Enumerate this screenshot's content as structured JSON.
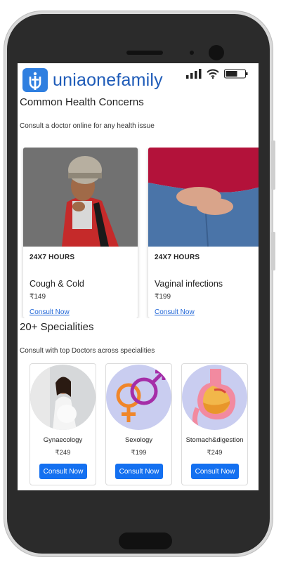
{
  "app": {
    "title": "uniaonefamily"
  },
  "status_icons": [
    "signal-icon",
    "wifi-icon",
    "battery-icon"
  ],
  "health_concerns": {
    "title": "Common Health Concerns",
    "subtitle": "Consult a doctor online for any health issue",
    "cards": [
      {
        "hours": "24X7 HOURS",
        "name": "Cough & Cold",
        "price": "₹149",
        "link": "Consult Now"
      },
      {
        "hours": "24X7 HOURS",
        "name": "Vaginal infections",
        "price": "₹199",
        "link": "Consult Now"
      }
    ]
  },
  "specialities": {
    "title": "20+ Specialities",
    "subtitle": "Consult with top Doctors across specialities",
    "items": [
      {
        "name": "Gynaecology",
        "price": "₹249",
        "button": "Consult Now"
      },
      {
        "name": "Sexology",
        "price": "₹199",
        "button": "Consult Now"
      },
      {
        "name": "Stomach&digestion",
        "price": "₹249",
        "button": "Consult Now"
      }
    ]
  },
  "colors": {
    "brand": "#1e5bb8",
    "logo_bg": "#2f7fe0",
    "button": "#1470f0",
    "link": "#2368d8"
  }
}
